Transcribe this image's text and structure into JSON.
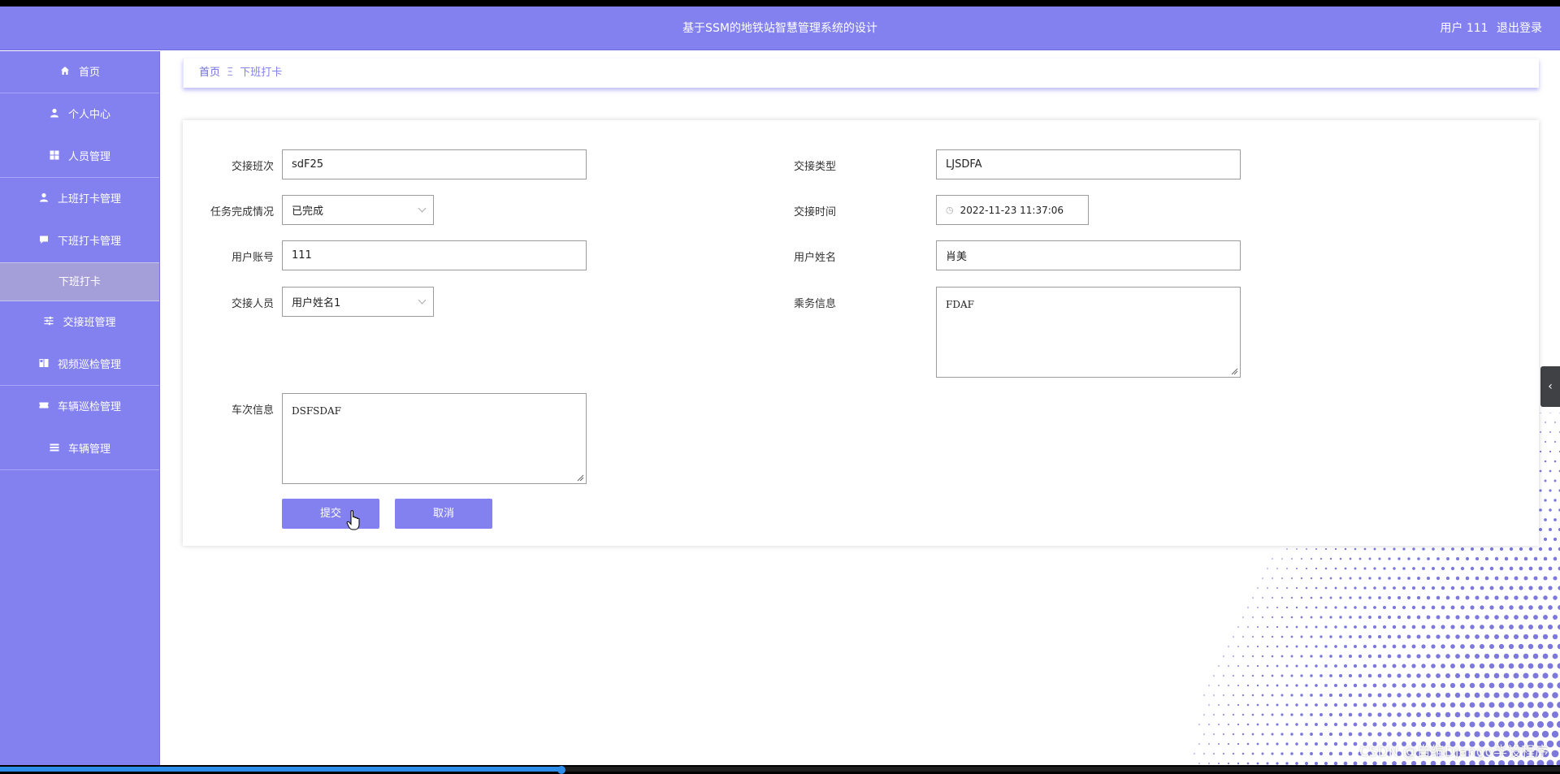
{
  "header": {
    "title": "基于SSM的地铁站智慧管理系统的设计",
    "user_label": "用户 111",
    "logout_label": "退出登录"
  },
  "sidebar": {
    "items": [
      {
        "label": "首页",
        "icon": "home-icon"
      },
      {
        "label": "个人中心",
        "icon": "user-icon"
      },
      {
        "label": "人员管理",
        "icon": "grid-icon"
      },
      {
        "label": "上班打卡管理",
        "icon": "user-icon"
      },
      {
        "label": "下班打卡管理",
        "icon": "chat-icon"
      },
      {
        "label": "下班打卡",
        "active": true
      },
      {
        "label": "交接班管理",
        "icon": "sliders-icon"
      },
      {
        "label": "视频巡检管理",
        "icon": "book-icon"
      },
      {
        "label": "车辆巡检管理",
        "icon": "ticket-icon"
      },
      {
        "label": "车辆管理",
        "icon": "list-icon"
      }
    ]
  },
  "breadcrumb": {
    "home": "首页",
    "separator": "Ξ",
    "current": "下班打卡"
  },
  "form": {
    "shift": {
      "label": "交接班次",
      "value": "sdF25"
    },
    "handover_type": {
      "label": "交接类型",
      "value": "LJSDFA"
    },
    "task_status": {
      "label": "任务完成情况",
      "value": "已完成"
    },
    "handover_time": {
      "label": "交接时间",
      "value": "2022-11-23 11:37:06"
    },
    "account": {
      "label": "用户账号",
      "value": "111"
    },
    "user_name": {
      "label": "用户姓名",
      "value": "肖美"
    },
    "handover_person": {
      "label": "交接人员",
      "value": "用户姓名1"
    },
    "crew_info": {
      "label": "乘务信息",
      "value": "FDAF"
    },
    "train_info": {
      "label": "车次信息",
      "value": "DSFSDAF"
    },
    "submit_label": "提交",
    "cancel_label": "取消"
  },
  "watermark": "CSDN @自编Django毕设程序",
  "video_progress": 0.36,
  "colors": {
    "primary": "#8381ef",
    "active_sub": "#a49fd8",
    "progress": "#2c8eea"
  }
}
